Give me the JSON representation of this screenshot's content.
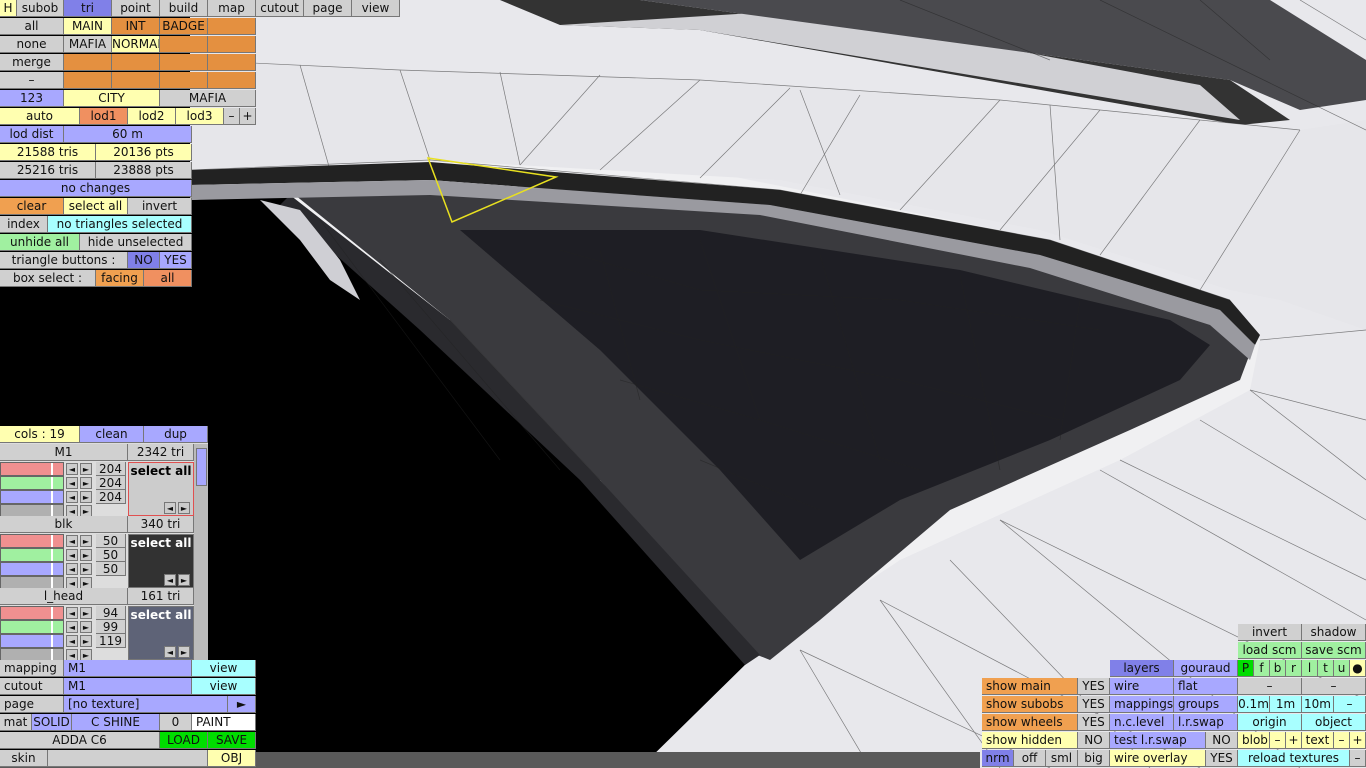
{
  "top": {
    "h": "H",
    "tabs": [
      "subob",
      "tri",
      "point",
      "build",
      "map",
      "cutout",
      "page",
      "view"
    ]
  },
  "left": {
    "all": "all",
    "none": "none",
    "merge": "merge",
    "dash": "–",
    "layers": [
      "MAIN",
      "INT",
      "BADGE",
      "MAFIA",
      "NORMAL"
    ],
    "num": "123",
    "city": "CITY",
    "mafia": "MAFIA",
    "auto": "auto",
    "lods": [
      "lod1",
      "lod2",
      "lod3"
    ],
    "minus": "–",
    "plus": "+",
    "lod_dist_label": "lod dist",
    "lod_dist": "60 m",
    "tris1": "21588 tris",
    "pts1": "20136 pts",
    "tris2": "25216 tris",
    "pts2": "23888 pts",
    "changes": "no changes",
    "clear": "clear",
    "select_all": "select all",
    "invert": "invert",
    "index": "index",
    "no_tri": "no triangles selected",
    "unhide": "unhide all",
    "hide_unsel": "hide unselected",
    "tri_buttons": "triangle buttons :",
    "no": "NO",
    "yes": "YES",
    "box_select": "box select :",
    "facing": "facing",
    "all2": "all"
  },
  "colors_panel": {
    "cols": "cols : 19",
    "clean": "clean",
    "dup": "dup",
    "materials": [
      {
        "name": "M1",
        "tris": "2342 tri",
        "rgb": [
          "204",
          "204",
          "204"
        ],
        "swatch": "#cccccc",
        "sel": "select all"
      },
      {
        "name": "blk",
        "tris": "340 tri",
        "rgb": [
          "50",
          "50",
          "50"
        ],
        "swatch": "#323232",
        "sel": "select all"
      },
      {
        "name": "l_head",
        "tris": "161 tri",
        "rgb": [
          "94",
          "99",
          "119"
        ],
        "swatch": "#5e6377",
        "sel": "select all"
      }
    ]
  },
  "bottom_left": {
    "mapping": "mapping",
    "mapping_val": "M1",
    "view": "view",
    "cutout": "cutout",
    "cutout_val": "M1",
    "page": "page",
    "page_val": "[no texture]",
    "page_arrow": "►",
    "mat": "mat",
    "solid": "SOLID",
    "cshine": "C SHINE",
    "zero": "0",
    "paint": "PAINT",
    "adda": "ADDA C6",
    "load": "LOAD",
    "save": "SAVE",
    "skin": "skin",
    "obj": "OBJ"
  },
  "bottom_right": {
    "invert": "invert",
    "shadow": "shadow",
    "load_scm": "load scm",
    "save_scm": "save scm",
    "layers": "layers",
    "gouraud": "gouraud",
    "letters": [
      "P",
      "f",
      "b",
      "r",
      "l",
      "t",
      "u",
      "●"
    ],
    "show_main": "show main",
    "yes": "YES",
    "wire": "wire",
    "flat": "flat",
    "dash": "–",
    "show_subobs": "show subobs",
    "mappings": "mappings",
    "groups": "groups",
    "dists": [
      "0.1m",
      "1m",
      "10m"
    ],
    "show_wheels": "show wheels",
    "nclevel": "n.c.level",
    "lrswap": "l.r.swap",
    "origin": "origin",
    "object": "object",
    "show_hidden": "show hidden",
    "no": "NO",
    "test_lr": "test l.r.swap",
    "blob": "blob",
    "minus": "–",
    "plus": "+",
    "text": "text",
    "nrm": "nrm",
    "off": "off",
    "sml": "sml",
    "big": "big",
    "wire_overlay": "wire overlay",
    "reload": "reload textures"
  }
}
